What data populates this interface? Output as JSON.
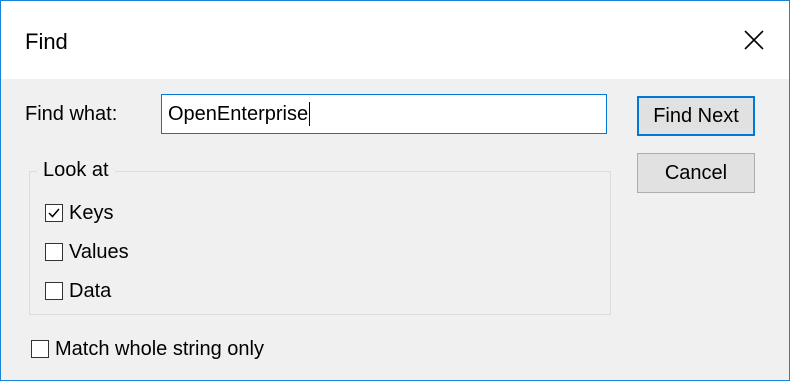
{
  "window": {
    "title": "Find"
  },
  "find": {
    "label": "Find what:",
    "value": "OpenEnterprise"
  },
  "buttons": {
    "find_next": "Find Next",
    "cancel": "Cancel"
  },
  "look_at": {
    "title": "Look at",
    "options": [
      {
        "label": "Keys",
        "checked": true
      },
      {
        "label": "Values",
        "checked": false
      },
      {
        "label": "Data",
        "checked": false
      }
    ]
  },
  "match_whole": {
    "label": "Match whole string only",
    "checked": false
  },
  "icons": {
    "close": "close-icon",
    "checkmark": "checkmark-icon"
  },
  "colors": {
    "accent": "#0078d7",
    "window_border": "#1883d7"
  }
}
